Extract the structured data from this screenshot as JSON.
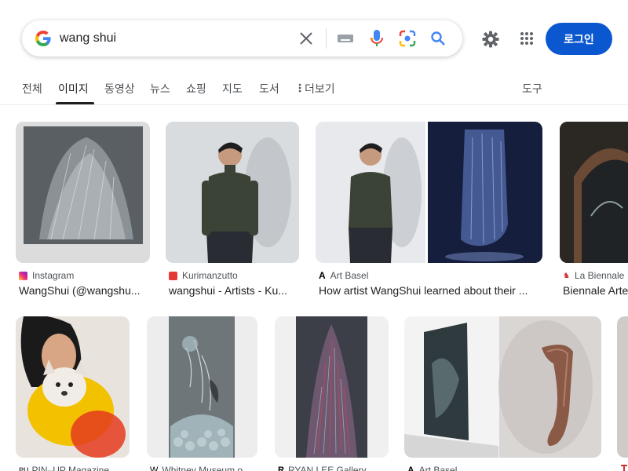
{
  "search": {
    "query": "wang shui"
  },
  "header": {
    "login_label": "로그인"
  },
  "tabs": [
    {
      "label": "전체"
    },
    {
      "label": "이미지"
    },
    {
      "label": "동영상"
    },
    {
      "label": "뉴스"
    },
    {
      "label": "쇼핑"
    },
    {
      "label": "지도"
    },
    {
      "label": "도서"
    },
    {
      "label": "더보기"
    },
    {
      "label": "도구"
    }
  ],
  "results_row1": [
    {
      "source": "Instagram",
      "title": "WangShui (@wangshu..."
    },
    {
      "source": "Kurimanzutto",
      "title": "wangshui - Artists - Ku..."
    },
    {
      "source": "Art Basel",
      "title": "How artist WangShui learned about their ..."
    },
    {
      "source": "La Biennale",
      "title": "Biennale Arte"
    }
  ],
  "results_row2": [
    {
      "source": "PIN–UP Magazine"
    },
    {
      "source": "Whitney Museum o..."
    },
    {
      "source": "RYAN LEE Gallery"
    },
    {
      "source": "Art Basel"
    }
  ],
  "colors": {
    "accent": "#0b57d0",
    "active_tab": "#1f1f1f",
    "muted_text": "#4d5156"
  },
  "icons": [
    "google-g-icon",
    "close-icon",
    "keyboard-icon",
    "mic-icon",
    "lens-icon",
    "search-icon",
    "gear-icon",
    "apps-grid-icon",
    "more-vert-icon"
  ]
}
